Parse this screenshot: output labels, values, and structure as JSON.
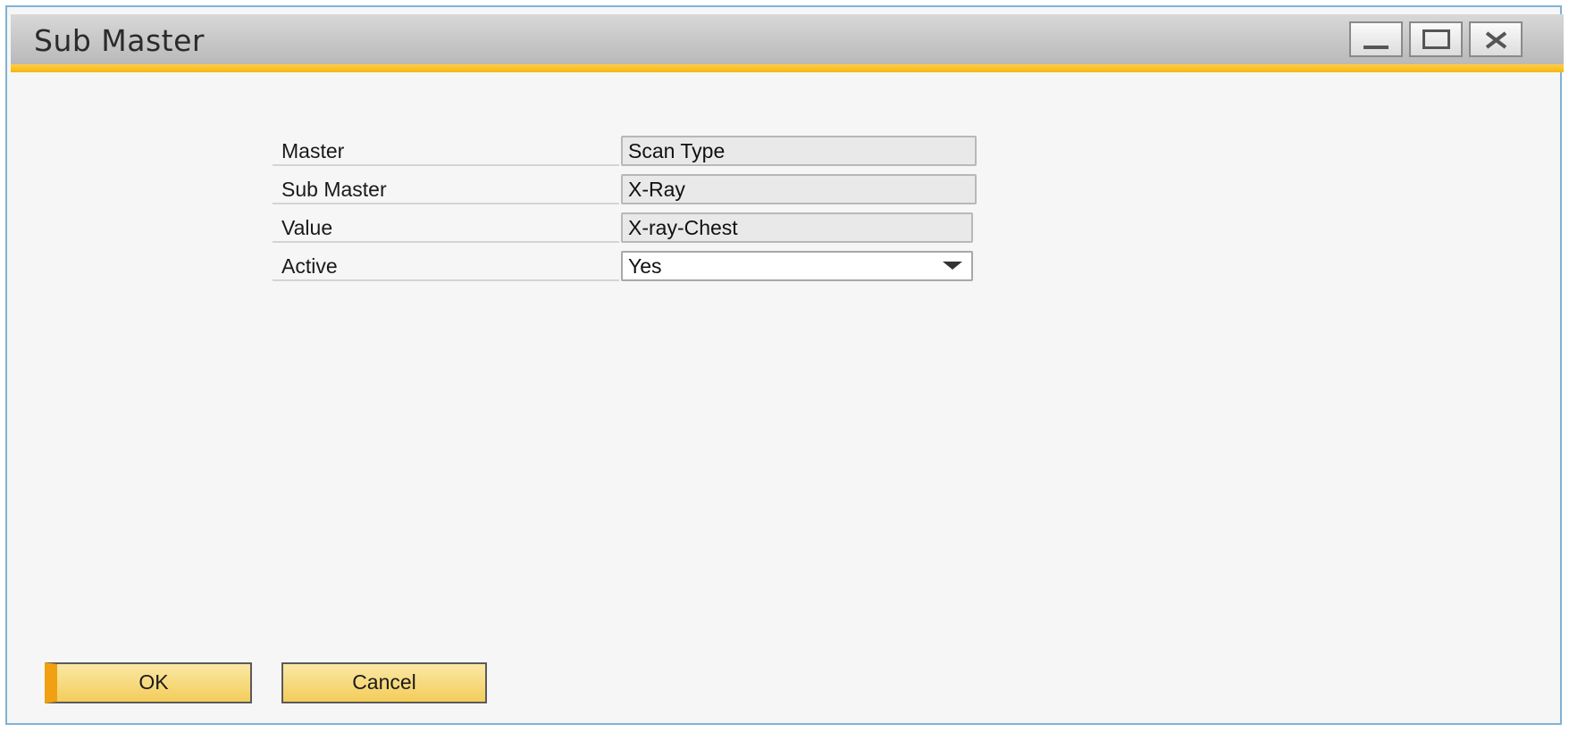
{
  "window": {
    "title": "Sub Master"
  },
  "form": {
    "fields": [
      {
        "label": "Master",
        "value": "Scan Type"
      },
      {
        "label": "Sub Master",
        "value": "X-Ray"
      },
      {
        "label": "Value",
        "value": "X-ray-Chest"
      },
      {
        "label": "Active",
        "value": "Yes"
      }
    ]
  },
  "buttons": {
    "ok_label": "OK",
    "cancel_label": "Cancel"
  },
  "colors": {
    "accent": "#f5b70e",
    "button_fill": "#f3cd5a",
    "window_border": "#7fb2d6"
  },
  "icons": {
    "minimize": "minimize-icon",
    "maximize": "maximize-icon",
    "close": "close-icon",
    "dropdown": "chevron-down-icon"
  }
}
